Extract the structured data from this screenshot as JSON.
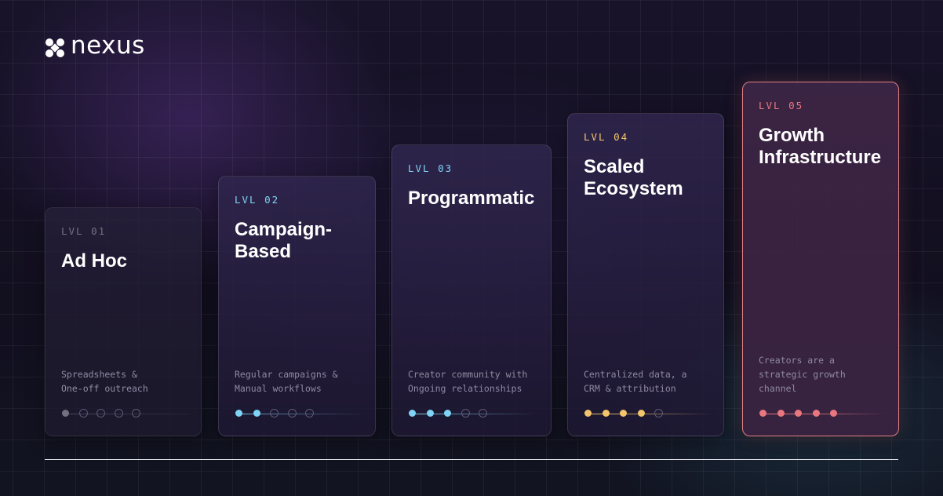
{
  "brand": {
    "name": "nexus",
    "logo_icon": "nexus-logo-icon"
  },
  "accent_colors": {
    "lvl_01": "#75707f",
    "lvl_02": "#7fd3f5",
    "lvl_03": "#7fd3f5",
    "lvl_04": "#f2c46b",
    "lvl_05": "#e9777f"
  },
  "levels": [
    {
      "label": "LVL 01",
      "title": "Ad Hoc",
      "description": [
        "Spreadsheets &",
        "One-off outreach"
      ],
      "filled": 1,
      "total": 5,
      "color": "#75707f"
    },
    {
      "label": "LVL 02",
      "title": "Campaign-\nBased",
      "description": [
        "Regular campaigns &",
        "Manual workflows"
      ],
      "filled": 2,
      "total": 5,
      "color": "#7fd3f5"
    },
    {
      "label": "LVL 03",
      "title": "Programmatic",
      "description": [
        "Creator community with",
        "Ongoing relationships"
      ],
      "filled": 3,
      "total": 5,
      "color": "#7fd3f5"
    },
    {
      "label": "LVL 04",
      "title": "Scaled\nEcosystem",
      "description": [
        "Centralized data, a",
        "CRM & attribution"
      ],
      "filled": 4,
      "total": 5,
      "color": "#f2c46b"
    },
    {
      "label": "LVL 05",
      "title": "Growth\nInfrastructure",
      "description": [
        "Creators are a",
        "strategic growth",
        "channel"
      ],
      "filled": 5,
      "total": 5,
      "color": "#e9777f"
    }
  ]
}
